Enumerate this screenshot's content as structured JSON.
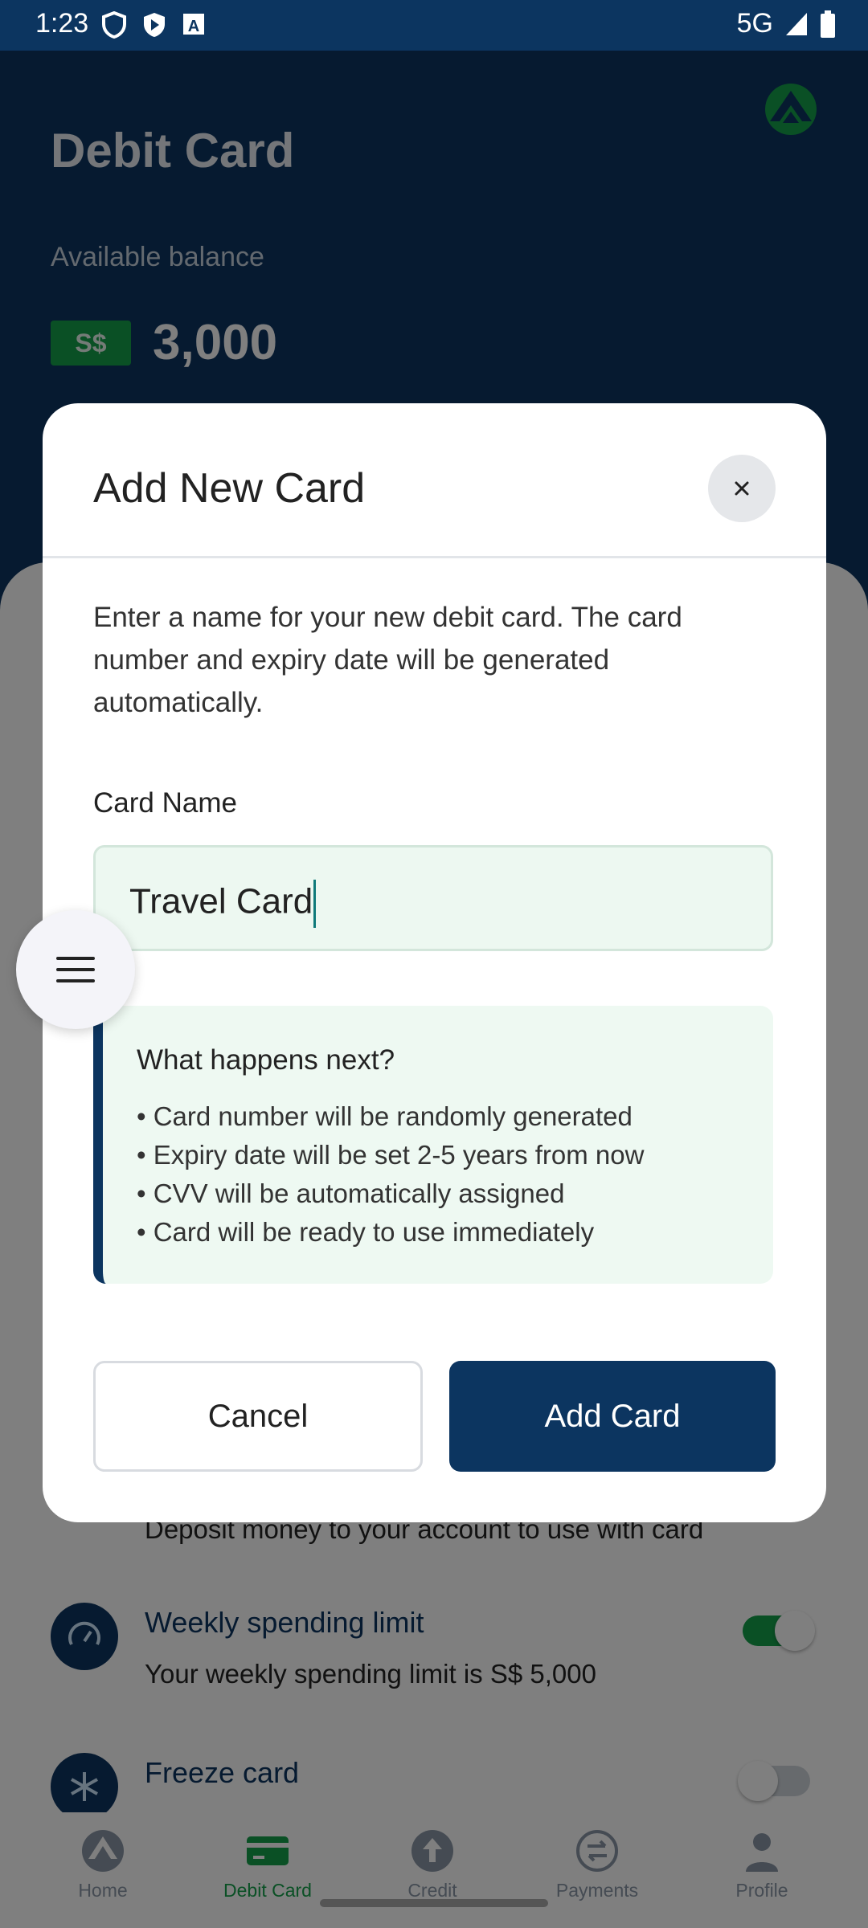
{
  "status_bar": {
    "time": "1:23",
    "network": "5G"
  },
  "header": {
    "title": "Debit Card",
    "balance_label": "Available balance",
    "currency": "S$",
    "balance": "3,000"
  },
  "background": {
    "deposit_text": "Deposit money to your account to use with card",
    "settings": [
      {
        "title": "Weekly spending limit",
        "subtitle": "Your weekly spending limit is S$ 5,000",
        "enabled": true
      },
      {
        "title": "Freeze card",
        "enabled": false
      }
    ]
  },
  "dialog": {
    "title": "Add New Card",
    "description": "Enter a name for your new debit card. The card number and expiry date will be generated automatically.",
    "field_label": "Card Name",
    "input_value": "Travel Card",
    "info_title": "What happens next?",
    "info_items": [
      "• Card number will be randomly generated",
      "• Expiry date will be set 2-5 years from now",
      "• CVV will be automatically assigned",
      "• Card will be ready to use immediately"
    ],
    "cancel_label": "Cancel",
    "add_label": "Add Card"
  },
  "nav": {
    "items": [
      {
        "label": "Home",
        "icon": "home-icon"
      },
      {
        "label": "Debit Card",
        "icon": "card-icon",
        "active": true
      },
      {
        "label": "Credit",
        "icon": "credit-icon"
      },
      {
        "label": "Payments",
        "icon": "payments-icon"
      },
      {
        "label": "Profile",
        "icon": "profile-icon"
      }
    ]
  },
  "colors": {
    "navy": "#0c3560",
    "green": "#14a04b",
    "mint": "#edf8f1"
  }
}
